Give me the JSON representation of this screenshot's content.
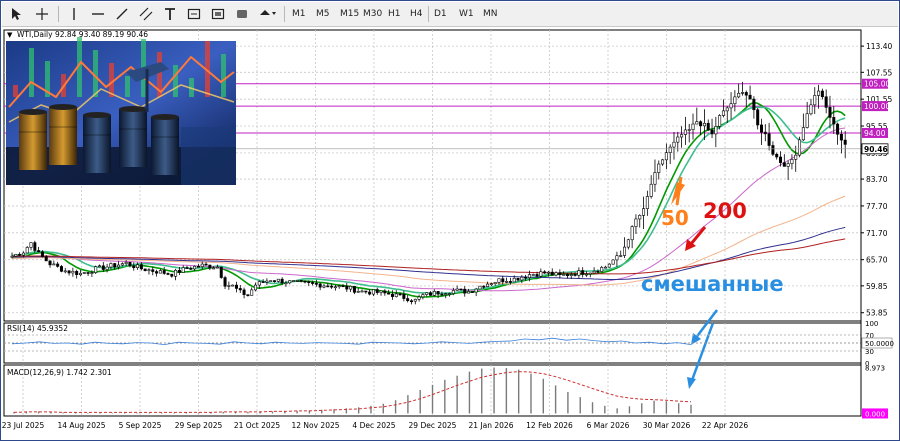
{
  "toolbar": {
    "tools": [
      "cursor-icon",
      "crosshair-icon",
      "vertical-line-icon",
      "horizontal-line-icon",
      "trendline-icon",
      "channel-icon",
      "text-icon",
      "label-icon",
      "rectangle-icon",
      "shapes-icon"
    ],
    "timeframes": [
      "M1",
      "M5",
      "M15",
      "M30",
      "H1",
      "H4",
      "D1",
      "W1",
      "MN"
    ],
    "active_timeframe": "D1"
  },
  "chart_data": {
    "type": "candlestick",
    "header": "WTI,Daily  92.84 93.40 89.19 90.46",
    "price_axis": {
      "ticks": [
        "113.40",
        "107.55",
        "101.55",
        "95.55",
        "89.55",
        "83.70",
        "77.70",
        "71.70",
        "65.70",
        "59.85",
        "53.85"
      ],
      "ylim": [
        52,
        117
      ],
      "last_price": "90.46"
    },
    "horizontal_levels": [
      {
        "value": 105.0,
        "label": "105.00"
      },
      {
        "value": 100.0,
        "label": "100.00"
      },
      {
        "value": 94.0,
        "label": "94.00"
      }
    ],
    "date_axis": [
      "23 Jul 2025",
      "14 Aug 2025",
      "5 Sep 2025",
      "29 Sep 2025",
      "21 Oct 2025",
      "12 Nov 2025",
      "4 Dec 2025",
      "29 Dec 2025",
      "21 Jan 2026",
      "12 Feb 2026",
      "6 Mar 2026",
      "30 Mar 2026",
      "22 Apr 2026"
    ],
    "price_path": [
      [
        0,
        66.5
      ],
      [
        3,
        67.5
      ],
      [
        5,
        69.5
      ],
      [
        7,
        67
      ],
      [
        10,
        64.8
      ],
      [
        14,
        63.2
      ],
      [
        18,
        62.6
      ],
      [
        22,
        63.6
      ],
      [
        26,
        64.3
      ],
      [
        30,
        64.9
      ],
      [
        34,
        63.7
      ],
      [
        38,
        63.1
      ],
      [
        42,
        62.5
      ],
      [
        46,
        63.8
      ],
      [
        50,
        64.4
      ],
      [
        54,
        64.1
      ],
      [
        56,
        60.3
      ],
      [
        58,
        59.8
      ],
      [
        60,
        58.4
      ],
      [
        62,
        57.8
      ],
      [
        64,
        60.1
      ],
      [
        68,
        61.3
      ],
      [
        72,
        60.8
      ],
      [
        76,
        60.4
      ],
      [
        80,
        60.2
      ],
      [
        84,
        59.9
      ],
      [
        88,
        59.4
      ],
      [
        92,
        58.6
      ],
      [
        96,
        58.4
      ],
      [
        100,
        57.9
      ],
      [
        104,
        57.1
      ],
      [
        106,
        56.6
      ],
      [
        108,
        57.7
      ],
      [
        112,
        58.4
      ],
      [
        116,
        58.8
      ],
      [
        120,
        58.6
      ],
      [
        124,
        60.2
      ],
      [
        128,
        61.1
      ],
      [
        132,
        61.4
      ],
      [
        136,
        62.4
      ],
      [
        140,
        62.8
      ],
      [
        144,
        62.1
      ],
      [
        148,
        62.7
      ],
      [
        152,
        63.1
      ],
      [
        156,
        64.1
      ],
      [
        158,
        65.6
      ],
      [
        160,
        66.6
      ],
      [
        162,
        70.6
      ],
      [
        164,
        74.6
      ],
      [
        166,
        76.6
      ],
      [
        168,
        82.6
      ],
      [
        170,
        86.6
      ],
      [
        172,
        89.6
      ],
      [
        174,
        91.6
      ],
      [
        176,
        93.6
      ],
      [
        178,
        94.6
      ],
      [
        180,
        96.6
      ],
      [
        182,
        95.6
      ],
      [
        184,
        93.6
      ],
      [
        186,
        97.6
      ],
      [
        188,
        99.6
      ],
      [
        190,
        101.6
      ],
      [
        192,
        103.6
      ],
      [
        194,
        101.6
      ],
      [
        196,
        95.6
      ],
      [
        198,
        93.6
      ],
      [
        200,
        89.6
      ],
      [
        202,
        87.6
      ],
      [
        204,
        86.6
      ],
      [
        206,
        89.6
      ],
      [
        208,
        95.6
      ],
      [
        210,
        100.6
      ],
      [
        212,
        103.6
      ],
      [
        214,
        99.6
      ],
      [
        216,
        95.6
      ],
      [
        218,
        92.6
      ],
      [
        220,
        90.5
      ]
    ],
    "moving_averages": [
      {
        "role": "fast",
        "color": "#009900"
      },
      {
        "role": "fast-2",
        "color": "#3fbf8f"
      },
      {
        "role": "50",
        "color": "#cc66cc"
      },
      {
        "role": "100",
        "color": "#f2b48c"
      },
      {
        "role": "150",
        "color": "#303090"
      },
      {
        "role": "200",
        "color": "#b02020"
      }
    ],
    "rsi": {
      "label": "RSI(14) 45.9352",
      "ticks": [
        "100",
        "70",
        "50.0000",
        "30",
        "0"
      ],
      "level": "50.0000",
      "values": [
        48,
        50,
        53,
        49,
        50,
        47,
        52,
        49,
        48,
        51,
        50,
        46,
        52,
        50,
        49,
        47,
        53,
        50,
        48,
        52,
        50,
        49,
        51,
        50,
        49,
        47,
        52,
        51,
        50,
        48,
        50,
        53,
        51,
        49,
        52,
        54,
        55,
        60,
        58,
        62,
        57,
        60,
        56,
        53,
        55,
        50,
        52,
        48,
        51,
        46
      ]
    },
    "macd": {
      "label": "MACD(12,26,9) 1.742 2.301",
      "ticks": [
        "8.973",
        "0.000"
      ],
      "ylim": [
        -0.5,
        9.5
      ],
      "histogram": [
        0.3,
        0.4,
        0.4,
        0.3,
        0.2,
        0.2,
        0.1,
        0.1,
        0.1,
        0.2,
        0.1,
        0.1,
        0.1,
        0.1,
        0.2,
        0.2,
        0.2,
        0.3,
        0.3,
        0.3,
        0.4,
        0.4,
        0.5,
        0.5,
        0.6,
        0.7,
        0.8,
        1.0,
        1.2,
        1.5,
        1.9,
        2.6,
        3.6,
        4.6,
        5.6,
        6.6,
        7.4,
        8.2,
        8.8,
        9.0,
        8.9,
        8.6,
        7.8,
        6.8,
        5.5,
        4.2,
        3.2,
        2.2,
        1.5,
        1.0,
        1.4,
        2.0,
        2.5,
        2.4,
        2.0,
        1.7
      ],
      "signal": [
        0.2,
        0.3,
        0.3,
        0.3,
        0.2,
        0.2,
        0.2,
        0.2,
        0.2,
        0.2,
        0.2,
        0.2,
        0.2,
        0.2,
        0.2,
        0.2,
        0.2,
        0.3,
        0.3,
        0.3,
        0.3,
        0.4,
        0.4,
        0.5,
        0.5,
        0.6,
        0.7,
        0.8,
        0.9,
        1.1,
        1.3,
        1.7,
        2.2,
        2.9,
        3.7,
        4.6,
        5.5,
        6.3,
        7.1,
        7.6,
        8.0,
        8.2,
        8.1,
        7.8,
        7.2,
        6.5,
        5.7,
        4.9,
        4.1,
        3.4,
        3.0,
        2.8,
        2.7,
        2.6,
        2.4,
        2.3
      ]
    },
    "annotations": [
      {
        "text": "50",
        "color": "#ff7f1a"
      },
      {
        "text": "200",
        "color": "#dd1111"
      },
      {
        "text": "смешанные",
        "color": "#2a8fe0"
      }
    ],
    "grid": true
  }
}
